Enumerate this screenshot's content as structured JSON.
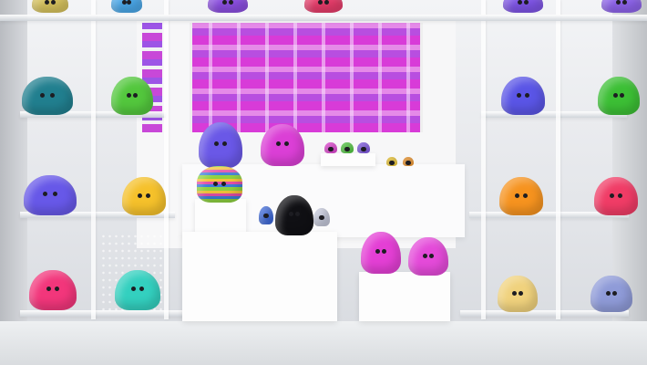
{
  "scene": {
    "description_colors": {
      "magenta": "#e23ed8",
      "purple": "#6a5ce8",
      "green": "#4cc83a",
      "teal": "#1f7f92",
      "yellow": "#f2c92a",
      "orange": "#f39220",
      "pink": "#f23b7b",
      "black": "#101014"
    }
  }
}
